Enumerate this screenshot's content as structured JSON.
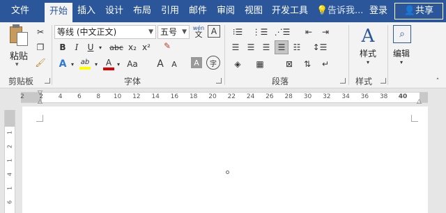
{
  "tabs": {
    "file": "文件",
    "home": "开始",
    "insert": "插入",
    "design": "设计",
    "layout": "布局",
    "references": "引用",
    "mailings": "邮件",
    "review": "审阅",
    "view": "视图",
    "developer": "开发工具"
  },
  "tell_me": "告诉我...",
  "login": "登录",
  "share": "共享",
  "clipboard": {
    "paste": "粘贴",
    "label": "剪贴板"
  },
  "font": {
    "name": "等线 (中文正文)",
    "size": "五号",
    "wen_top": "wén",
    "wen_char": "文",
    "border_char": "A",
    "bold": "B",
    "italic": "I",
    "underline": "U",
    "strike": "abc",
    "subscript": "x₂",
    "superscript": "x²",
    "text_effects": "A",
    "highlight": "ab",
    "font_color": "A",
    "grow": "A",
    "shrink": "A",
    "shading": "A",
    "enclose": "字",
    "label": "字体"
  },
  "paragraph": {
    "label": "段落"
  },
  "styles": {
    "button": "样式",
    "label": "样式"
  },
  "editing": {
    "button": "编辑"
  },
  "ruler": {
    "tab_selector": "L",
    "ticks": [
      "2",
      "2",
      "4",
      "6",
      "8",
      "10",
      "12",
      "14",
      "16",
      "18",
      "20",
      "22",
      "24",
      "26",
      "28",
      "30",
      "32",
      "34",
      "36",
      "38",
      "40"
    ]
  },
  "vruler": {
    "ticks": [
      "1",
      "2",
      "1",
      "4",
      "1",
      "6"
    ]
  },
  "colors": {
    "accent": "#2b579a",
    "highlight": "#ffff00",
    "font_color": "#e00000"
  }
}
